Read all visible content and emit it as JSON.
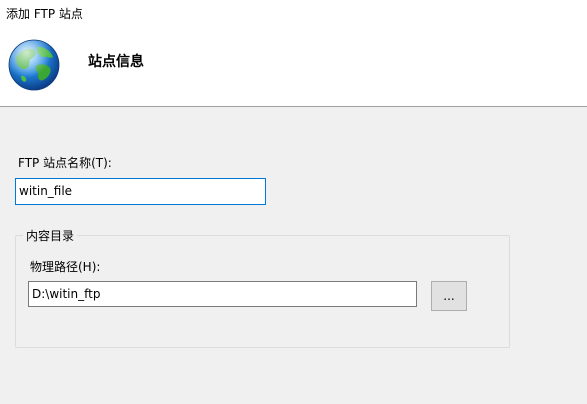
{
  "window": {
    "title": "添加 FTP 站点"
  },
  "header": {
    "icon": "globe-icon",
    "title": "站点信息"
  },
  "form": {
    "site_name_label": "FTP 站点名称(T):",
    "site_name_value": "witin_file",
    "content_group_label": "内容目录",
    "physical_path_label": "物理路径(H):",
    "physical_path_value": "D:\\witin_ftp",
    "browse_button_label": "..."
  },
  "colors": {
    "body_background": "#f0f0f0",
    "focus_border": "#0078d7"
  }
}
